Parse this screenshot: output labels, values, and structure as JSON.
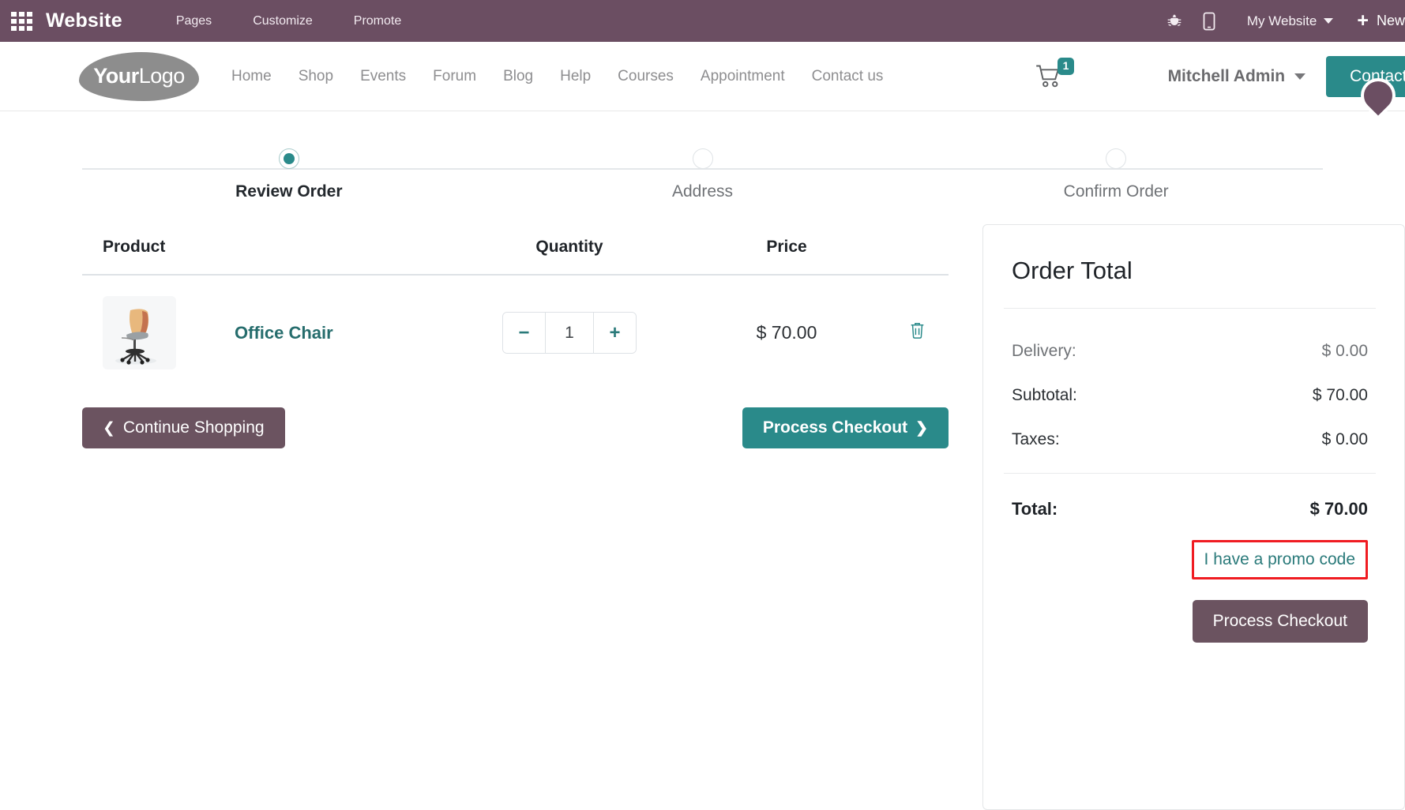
{
  "backend_navbar": {
    "apps_icon": "apps-grid-icon",
    "brand": "Website",
    "menu": [
      {
        "label": "Pages"
      },
      {
        "label": "Customize"
      },
      {
        "label": "Promote"
      }
    ],
    "bug_icon": "bug-icon",
    "mobile_icon": "mobile-preview-icon",
    "website_selector": "My Website",
    "new_label": "New",
    "plus_icon": "plus-icon",
    "background_color": "#6b4e62"
  },
  "site_header": {
    "logo": {
      "bold_part": "Your",
      "light_part": "Logo"
    },
    "nav": [
      {
        "label": "Home"
      },
      {
        "label": "Shop"
      },
      {
        "label": "Events"
      },
      {
        "label": "Forum"
      },
      {
        "label": "Blog"
      },
      {
        "label": "Help"
      },
      {
        "label": "Courses"
      },
      {
        "label": "Appointment"
      },
      {
        "label": "Contact us"
      }
    ],
    "cart_icon": "shopping-cart-icon",
    "cart_count": "1",
    "user_name": "Mitchell Admin",
    "contact_button": "Contact Us",
    "accent_color": "#2a8a8a"
  },
  "wizard": {
    "steps": [
      {
        "label": "Review Order",
        "state": "active"
      },
      {
        "label": "Address",
        "state": "inactive"
      },
      {
        "label": "Confirm Order",
        "state": "inactive"
      }
    ]
  },
  "cart": {
    "headers": {
      "product": "Product",
      "quantity": "Quantity",
      "price": "Price"
    },
    "rows": [
      {
        "name": "Office Chair",
        "image": "office-chair-thumbnail",
        "quantity": "1",
        "price": "$ 70.00",
        "minus_label": "−",
        "plus_label": "+",
        "delete_icon": "trash-icon"
      }
    ],
    "continue_shopping": "Continue Shopping",
    "process_checkout": "Process Checkout"
  },
  "order_total": {
    "title": "Order Total",
    "lines": [
      {
        "label": "Delivery:",
        "value": "$ 0.00",
        "emphasis": "muted"
      },
      {
        "label": "Subtotal:",
        "value": "$ 70.00",
        "emphasis": "dark"
      },
      {
        "label": "Taxes:",
        "value": "$ 0.00",
        "emphasis": "dark"
      }
    ],
    "total_label": "Total:",
    "total_value": "$ 70.00",
    "promo_link": "I have a promo code",
    "promo_highlight_color": "#f01c22",
    "checkout_button": "Process Checkout"
  }
}
